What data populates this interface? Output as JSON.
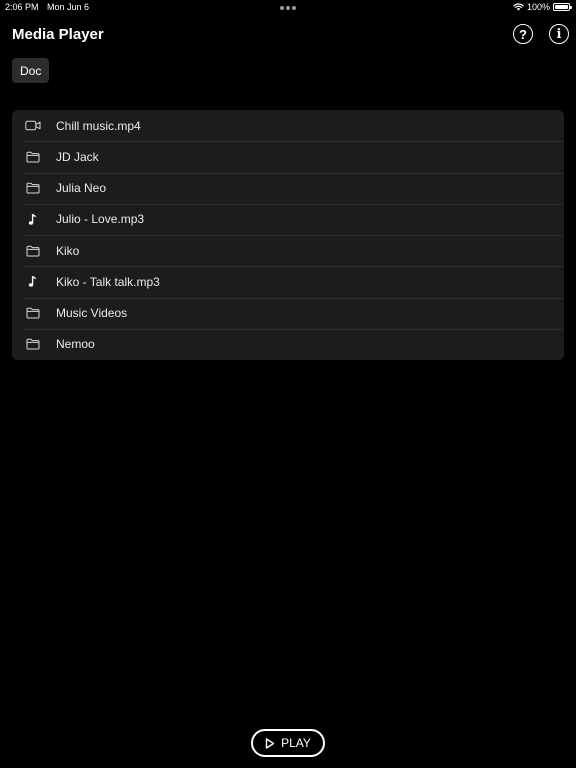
{
  "status_bar": {
    "time": "2:06 PM",
    "date": "Mon Jun 6",
    "battery": "100%",
    "battery_level": 1.0
  },
  "header": {
    "title": "Media Player",
    "help_label": "?",
    "info_label": "i"
  },
  "breadcrumb": {
    "label": "Doc"
  },
  "files": [
    {
      "name": "Chill music.mp4",
      "icon": "video-icon"
    },
    {
      "name": "JD Jack",
      "icon": "folder-icon"
    },
    {
      "name": "Julia Neo",
      "icon": "folder-icon"
    },
    {
      "name": "Julio - Love.mp3",
      "icon": "music-note-icon"
    },
    {
      "name": "Kiko",
      "icon": "folder-icon"
    },
    {
      "name": "Kiko - Talk talk.mp3",
      "icon": "music-note-icon"
    },
    {
      "name": "Music Videos",
      "icon": "folder-icon"
    },
    {
      "name": "Nemoo",
      "icon": "folder-icon"
    }
  ],
  "player": {
    "play_label": "PLAY"
  },
  "colors": {
    "background": "#000000",
    "list_background": "#1c1c1e",
    "chip_background": "#2c2c2e",
    "text": "#ffffff"
  }
}
